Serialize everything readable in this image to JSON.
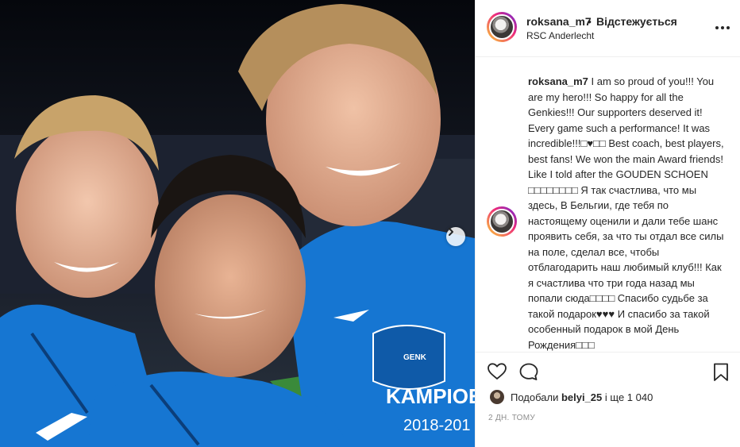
{
  "header": {
    "username": "roksana_m7",
    "dot": "•",
    "follow_status": "Відстежується",
    "location": "RSC Anderlecht",
    "more_icon": "more-horizontal-icon"
  },
  "photo": {
    "jersey_text": "KAMPIOE",
    "season_text": "2018-201",
    "badge_text": "GENK",
    "next_icon": "chevron-right-icon"
  },
  "caption": {
    "username": "roksana_m7",
    "text": " I am so proud of you!!! You are my hero!!! So happy for all the Genkies!!! Our supporters deserved it! Every game such a performance! It was incredible!!!□♥□□ Best coach, best players, best fans! We won the main Award friends! Like I told after the GOUDEN SCHOEN □□□□□□□□ Я так счастлива, что мы здесь, В Бельгии, где тебя по настоящему оценили и дали тебе шанс проявить себя, за что ты отдал все силы на поле, сделал все, чтобы отблагодарить наш любимый клуб!!! Как я счастлива что три года назад мы попали сюда□□□□ Спасибо судьбе за такой подарок♥♥♥ И спасибо за такой особенный подарок в мой День Рождения□□□"
  },
  "actions": {
    "like_icon": "heart-icon",
    "comment_icon": "comment-icon",
    "save_icon": "bookmark-icon",
    "likes_prefix": "Подобали ",
    "likes_user": "belyi_25",
    "likes_suffix": " і ще 1 040",
    "timestamp": "2 ДН. ТОМУ"
  },
  "colors": {
    "jersey_blue": "#1676d2",
    "text": "#262626",
    "muted": "#8e8e8e",
    "border": "#efefef"
  }
}
